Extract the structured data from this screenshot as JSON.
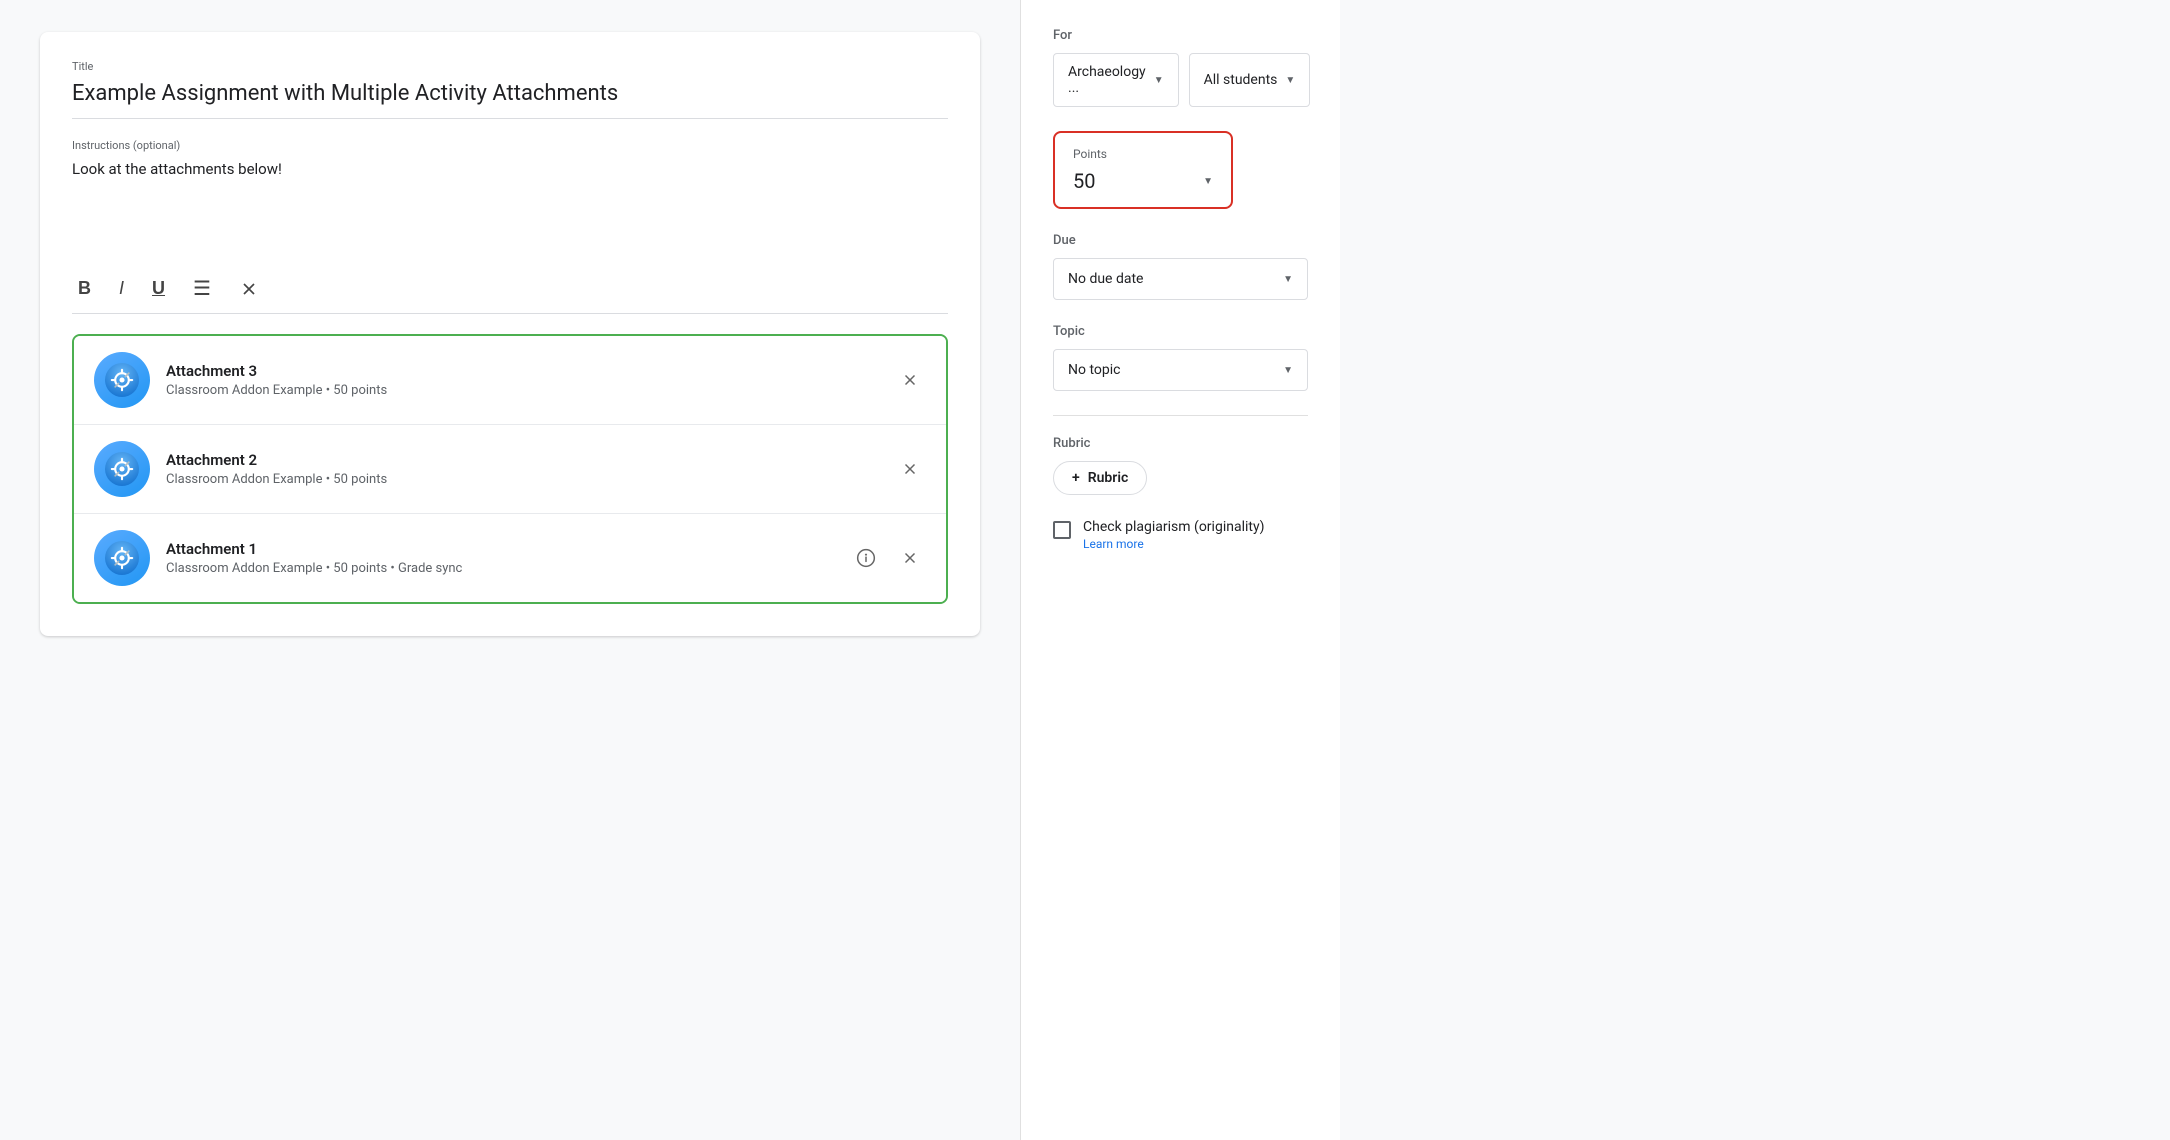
{
  "title_label": "Title",
  "title_value": "Example Assignment with Multiple Activity Attachments",
  "instructions_label": "Instructions (optional)",
  "instructions_value": "Look at the attachments below!",
  "toolbar": {
    "bold": "B",
    "italic": "I",
    "underline": "U",
    "list": "≡",
    "clear": "✕"
  },
  "attachments": [
    {
      "name": "Attachment 3",
      "meta": "Classroom Addon Example • 50 points",
      "has_info": false
    },
    {
      "name": "Attachment 2",
      "meta": "Classroom Addon Example • 50 points",
      "has_info": false
    },
    {
      "name": "Attachment 1",
      "meta": "Classroom Addon Example • 50 points • Grade sync",
      "has_info": true
    }
  ],
  "sidebar": {
    "for_label": "For",
    "class_dropdown": "Archaeology ...",
    "students_dropdown": "All students",
    "points_label": "Points",
    "points_value": "50",
    "due_label": "Due",
    "due_value": "No due date",
    "topic_label": "Topic",
    "topic_value": "No topic",
    "rubric_label": "Rubric",
    "rubric_btn": "Rubric",
    "plus_icon": "+",
    "plagiarism_label": "Check plagiarism (originality)",
    "plagiarism_link": "Learn more"
  }
}
